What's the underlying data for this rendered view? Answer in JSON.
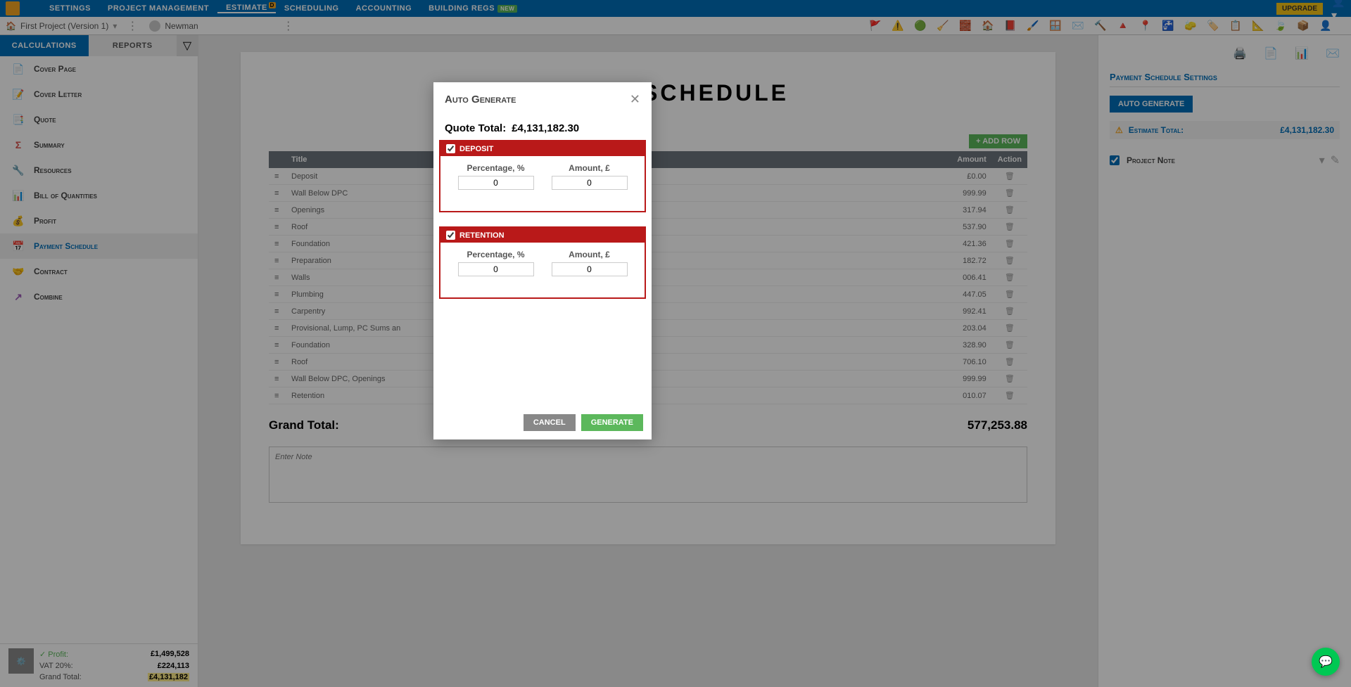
{
  "topnav": {
    "items": [
      "SETTINGS",
      "PROJECT MANAGEMENT",
      "ESTIMATE",
      "SCHEDULING",
      "ACCOUNTING",
      "BUILDING REGS"
    ],
    "estimate_badge": "D",
    "new_badge": "NEW",
    "upgrade": "UPGRADE"
  },
  "subheader": {
    "project": "First Project (Version 1)",
    "user": "Newman"
  },
  "tabs": {
    "calculations": "CALCULATIONS",
    "reports": "REPORTS"
  },
  "sidebar": {
    "items": [
      {
        "label": "Cover Page",
        "icon": "📄",
        "color": "#d9534f"
      },
      {
        "label": "Cover Letter",
        "icon": "📝",
        "color": "#5cb85c"
      },
      {
        "label": "Quote",
        "icon": "📑",
        "color": "#5bc0de"
      },
      {
        "label": "Summary",
        "icon": "Σ",
        "color": "#d9534f"
      },
      {
        "label": "Resources",
        "icon": "🔧",
        "color": "#888"
      },
      {
        "label": "Bill of Quantities",
        "icon": "📊",
        "color": "#5cb85c"
      },
      {
        "label": "Profit",
        "icon": "💰",
        "color": "#d9534f"
      },
      {
        "label": "Payment Schedule",
        "icon": "📅",
        "color": "#f5a623"
      },
      {
        "label": "Contract",
        "icon": "🤝",
        "color": "#8b4513"
      },
      {
        "label": "Combine",
        "icon": "↗",
        "color": "#9b59b6"
      }
    ],
    "footer": {
      "profit_label": "Profit:",
      "profit_value": "£1,499,528",
      "vat_label": "VAT 20%:",
      "vat_value": "£224,113",
      "grand_label": "Grand Total:",
      "grand_value": "£4,131,182"
    }
  },
  "document": {
    "title": "PAYMENT SCHEDULE",
    "add_row": "ADD ROW",
    "headers": {
      "title": "Title",
      "amount": "Amount",
      "action": "Action"
    },
    "rows": [
      {
        "title": "Deposit",
        "amount": "£0.00"
      },
      {
        "title": "Wall Below DPC",
        "amount": "999.99"
      },
      {
        "title": "Openings",
        "amount": "317.94"
      },
      {
        "title": "Roof",
        "amount": "537.90"
      },
      {
        "title": "Foundation",
        "amount": "421.36"
      },
      {
        "title": "Preparation",
        "amount": "182.72"
      },
      {
        "title": "Walls",
        "amount": "006.41"
      },
      {
        "title": "Plumbing",
        "amount": "447.05"
      },
      {
        "title": "Carpentry",
        "amount": "992.41"
      },
      {
        "title": "Provisional, Lump, PC Sums an",
        "amount": "203.04"
      },
      {
        "title": "Foundation",
        "amount": "328.90"
      },
      {
        "title": "Roof",
        "amount": "706.10"
      },
      {
        "title": "Wall Below DPC, Openings",
        "amount": "999.99"
      },
      {
        "title": "Retention",
        "amount": "010.07"
      }
    ],
    "grand_total_label": "Grand Total:",
    "grand_total_value": "577,253.88",
    "note_placeholder": "Enter Note"
  },
  "right": {
    "settings_title": "Payment Schedule Settings",
    "auto_generate": "AUTO GENERATE",
    "est_label": "Estimate Total:",
    "est_value": "£4,131,182.30",
    "project_note": "Project Note"
  },
  "modal": {
    "title": "Auto Generate",
    "quote_total_label": "Quote Total:",
    "quote_total_value": "£4,131,182.30",
    "deposit": {
      "header": "DEPOSIT",
      "pct_label": "Percentage, %",
      "pct_value": "0",
      "amt_label": "Amount, £",
      "amt_value": "0"
    },
    "retention": {
      "header": "RETENTION",
      "pct_label": "Percentage, %",
      "pct_value": "0",
      "amt_label": "Amount, £",
      "amt_value": "0"
    },
    "cancel": "CANCEL",
    "generate": "GENERATE"
  }
}
